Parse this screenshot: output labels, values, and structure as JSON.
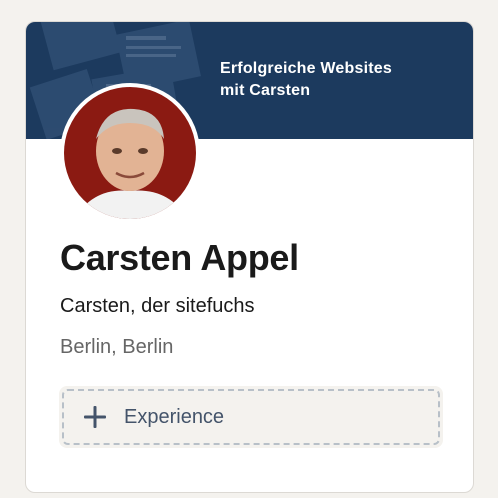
{
  "banner": {
    "line1": "Erfolgreiche Websites",
    "line2": "mit Carsten"
  },
  "profile": {
    "name": "Carsten Appel",
    "headline": "Carsten, der sitefuchs",
    "location": "Berlin, Berlin"
  },
  "actions": {
    "add_experience_label": "Experience"
  },
  "icons": {
    "add": "plus-icon",
    "photo": "profile-photo"
  },
  "colors": {
    "banner": "#1c3a5e",
    "avatar_bg": "#8b1a12",
    "secondary_text": "#666666"
  }
}
